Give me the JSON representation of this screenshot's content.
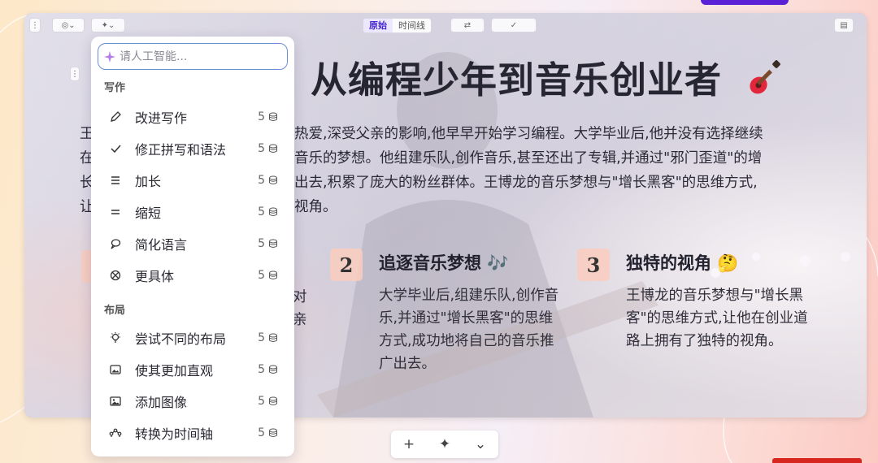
{
  "slide": {
    "title": "从编程少年到音乐创业者",
    "view_tabs": [
      "原始",
      "时间线"
    ],
    "paragraph_left_fragments": [
      "王",
      "在",
      "长",
      "让"
    ],
    "paragraph_lines": [
      "热爱,深受父亲的影响,他早早开始学习编程。大学毕业后,他并没有选择继续",
      "音乐的梦想。他组建乐队,创作音乐,甚至还出了专辑,并通过\"邪门歪道\"的增",
      "出去,积累了庞大的粉丝群体。王博龙的音乐梦想与\"增长黑客\"的思维方式,",
      "视角。"
    ],
    "feature_1_fragment": "对\n亲",
    "features": [
      {
        "num": "2",
        "title": "追逐音乐梦想 🎶",
        "body": "大学毕业后,组建乐队,创作音乐,并通过\"增长黑客\"的思维方式,成功地将自己的音乐推广出去。"
      },
      {
        "num": "3",
        "title": "独特的视角 🤔",
        "body": "王博龙的音乐梦想与\"增长黑客\"的思维方式,让他在创业道路上拥有了独特的视角。"
      }
    ]
  },
  "ai_panel": {
    "placeholder": "请人工智能...",
    "sections": [
      {
        "label": "写作",
        "items": [
          {
            "label": "改进写作",
            "cost": "5",
            "icon": "pen-icon"
          },
          {
            "label": "修正拼写和语法",
            "cost": "5",
            "icon": "check-icon"
          },
          {
            "label": "加长",
            "cost": "5",
            "icon": "lines-long-icon"
          },
          {
            "label": "缩短",
            "cost": "5",
            "icon": "lines-short-icon"
          },
          {
            "label": "简化语言",
            "cost": "5",
            "icon": "speech-bubble-icon"
          },
          {
            "label": "更具体",
            "cost": "5",
            "icon": "target-icon"
          }
        ]
      },
      {
        "label": "布局",
        "items": [
          {
            "label": "尝试不同的布局",
            "cost": "5",
            "icon": "lightbulb-icon"
          },
          {
            "label": "使其更加直观",
            "cost": "5",
            "icon": "image-frame-icon"
          },
          {
            "label": "添加图像",
            "cost": "5",
            "icon": "image-icon"
          },
          {
            "label": "转换为时间轴",
            "cost": "5",
            "icon": "timeline-icon"
          }
        ]
      }
    ]
  },
  "bottom_toolbar": {
    "add": "+",
    "ai": "✦",
    "more": "⌄"
  },
  "colors": {
    "accent": "#4b2bd1",
    "number_badge": "#facdbe",
    "input_border": "#6b8fd6"
  }
}
